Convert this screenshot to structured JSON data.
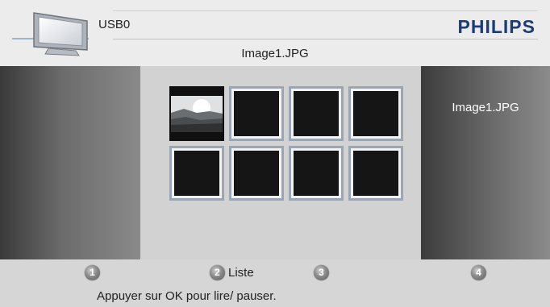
{
  "header": {
    "source_label": "USB0",
    "brand": "PHILIPS",
    "current_file": "Image1.JPG"
  },
  "info_panel": {
    "title": "Image1.JPG"
  },
  "thumbnails": {
    "count": 8,
    "selected_index": 0
  },
  "footer": {
    "keys": [
      {
        "number": "1",
        "label": ""
      },
      {
        "number": "2",
        "label": "Liste"
      },
      {
        "number": "3",
        "label": ""
      },
      {
        "number": "4",
        "label": ""
      }
    ],
    "hint": "Appuyer sur OK pour lire/ pauser."
  },
  "colors": {
    "brand": "#1c3b7a",
    "selection_border": "#9aa6b4"
  }
}
